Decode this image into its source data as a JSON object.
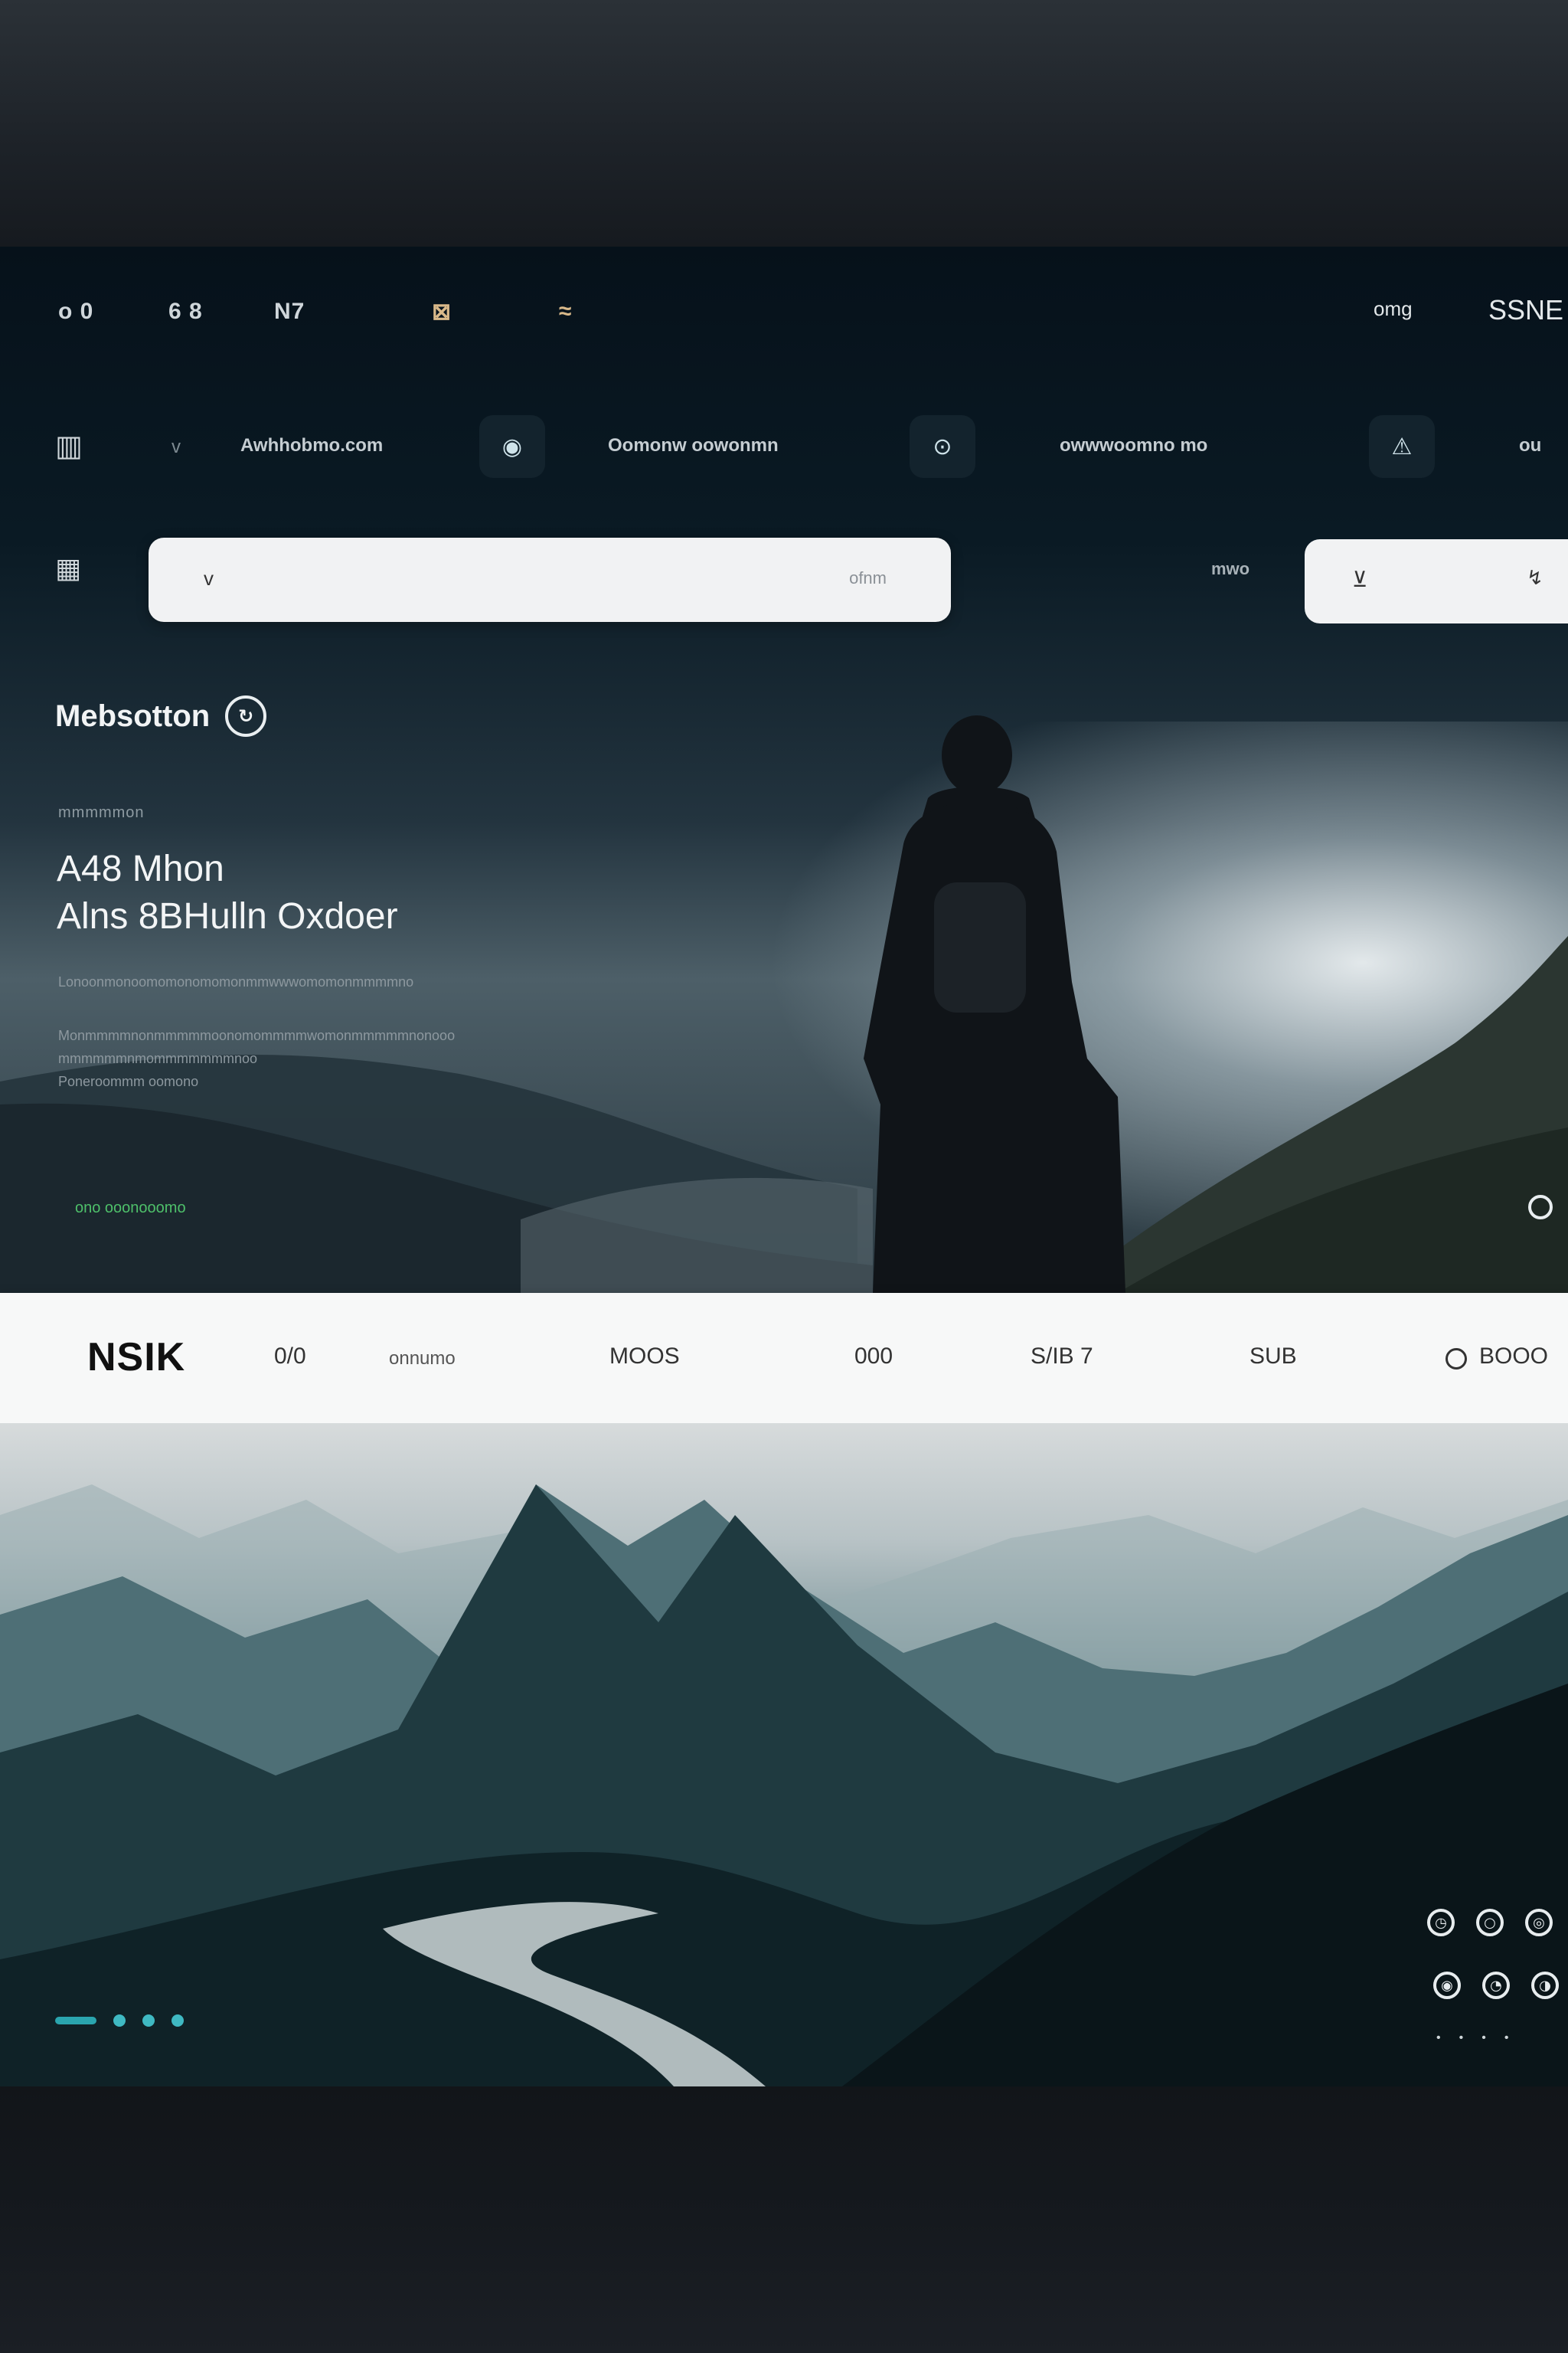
{
  "topnav": {
    "items": [
      "o 0",
      "6 8",
      "N7",
      "⊠",
      "≈"
    ],
    "right_a": "omg",
    "right_b": "SSNE"
  },
  "toolbar": {
    "links": [
      "Awhhobmo.com",
      "Oomonw oowonmn",
      "owwwoomno mo"
    ],
    "buttons": [
      "◉",
      "⊙",
      "⚠"
    ]
  },
  "search": {
    "placeholder": "",
    "field_label": "ofnm",
    "filter_label": "mwo"
  },
  "hero": {
    "section_title": "Mebsotton",
    "eyebrow": "mmmmmon",
    "headline_1": "A48 Mhon",
    "headline_2": "Alns 8BHulln Oxdoer",
    "body_lines": [
      "Lonoonmonoomomonomomonmmwwwomomonmmmmno",
      "Monmmmmnonmmmmmoonomommmmwomonmmmmmnonooo",
      "mmmmmmnmommmmmmmnoo",
      "Poneroommm oomono"
    ],
    "status": "ono ooonooomo"
  },
  "navbar": {
    "brand": "NSIK",
    "items": [
      "0/0",
      "onnumo",
      "MOOS",
      "000",
      "S/IB 7",
      "SUB",
      "BOOO"
    ]
  },
  "colors": {
    "accent": "#2aa5ae",
    "status_green": "#4ec06a",
    "hero_dark": "#06111a",
    "navbar_bg": "#f7f8f8"
  },
  "icons": [
    "menu-icon",
    "grid-icon",
    "chevron-down-icon",
    "search-icon",
    "alert-icon",
    "clock-icon",
    "media-control-icon"
  ]
}
